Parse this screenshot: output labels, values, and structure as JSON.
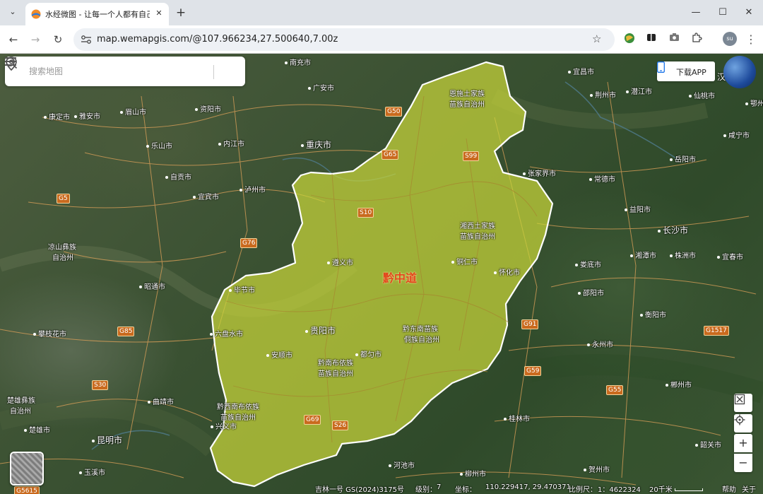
{
  "browser": {
    "tab_title": "水经微图 - 让每一个人都有自己",
    "url": "map.wemapgis.com/@107.966234,27.500640,7.00z",
    "profile_initials": "su"
  },
  "search": {
    "placeholder": "搜索地图"
  },
  "download_app_label": "下载APP",
  "region_label": "黔中道",
  "cities": [
    {
      "name": "南充市"
    },
    {
      "name": "广安市"
    },
    {
      "name": "宜昌市"
    },
    {
      "name": "荆州市"
    },
    {
      "name": "潜江市"
    },
    {
      "name": "武汉市"
    },
    {
      "name": "仙桃市"
    },
    {
      "name": "鄂州市"
    },
    {
      "name": "康定市"
    },
    {
      "name": "雅安市"
    },
    {
      "name": "眉山市"
    },
    {
      "name": "资阳市"
    },
    {
      "name": "恩施土家族"
    },
    {
      "name": "苗族自治州"
    },
    {
      "name": "乐山市"
    },
    {
      "name": "内江市"
    },
    {
      "name": "重庆市"
    },
    {
      "name": "咸宁市"
    },
    {
      "name": "岳阳市"
    },
    {
      "name": "张家界市"
    },
    {
      "name": "常德市"
    },
    {
      "name": "自贡市"
    },
    {
      "name": "宜宾市"
    },
    {
      "name": "泸州市"
    },
    {
      "name": "益阳市"
    },
    {
      "name": "湘西土家族"
    },
    {
      "name": "苗族自治州"
    },
    {
      "name": "长沙市"
    },
    {
      "name": "凉山彝族"
    },
    {
      "name": "自治州"
    },
    {
      "name": "湘潭市"
    },
    {
      "name": "株洲市"
    },
    {
      "name": "宜春市"
    },
    {
      "name": "遵义市"
    },
    {
      "name": "铜仁市"
    },
    {
      "name": "怀化市"
    },
    {
      "name": "娄底市"
    },
    {
      "name": "昭通市"
    },
    {
      "name": "毕节市"
    },
    {
      "name": "邵阳市"
    },
    {
      "name": "衡阳市"
    },
    {
      "name": "攀枝花市"
    },
    {
      "name": "六盘水市"
    },
    {
      "name": "贵阳市"
    },
    {
      "name": "黔东南苗族"
    },
    {
      "name": "侗族自治州"
    },
    {
      "name": "永州市"
    },
    {
      "name": "安顺市"
    },
    {
      "name": "都匀市"
    },
    {
      "name": "黔南布依族"
    },
    {
      "name": "苗族自治州"
    },
    {
      "name": "郴州市"
    },
    {
      "name": "楚雄彝族"
    },
    {
      "name": "自治州"
    },
    {
      "name": "曲靖市"
    },
    {
      "name": "黔西南布依族"
    },
    {
      "name": "苗族自治州"
    },
    {
      "name": "兴义市"
    },
    {
      "name": "楚雄市"
    },
    {
      "name": "昆明市"
    },
    {
      "name": "桂林市"
    },
    {
      "name": "韶关市"
    },
    {
      "name": "玉溪市"
    },
    {
      "name": "河池市"
    },
    {
      "name": "柳州市"
    },
    {
      "name": "贺州市"
    },
    {
      "name": "汉"
    }
  ],
  "highways": [
    "G50",
    "G65",
    "S99",
    "G5",
    "S10",
    "G76",
    "G85",
    "G91",
    "G1517",
    "G59",
    "S30",
    "G55",
    "G69",
    "S26",
    "G5615"
  ],
  "status": {
    "copyright": "吉林一号 GS(2024)3175号",
    "level_label": "级别：",
    "level_value": "7",
    "coord_label": "坐标：",
    "coord_value": "110.229417, 29.470371",
    "scale_label": "比例尺：",
    "scale_value": "1：4622324",
    "scale_bar_label": "20千米",
    "help": "帮助",
    "close": "关于"
  },
  "colors": {
    "region_fill": "#c8d63a",
    "region_stroke": "#ffffff",
    "road": "#e0a25a",
    "accent": "#1a73e8"
  },
  "icons": [
    "chevron-down-icon",
    "close-icon",
    "plus-icon",
    "minimize-icon",
    "maximize-icon",
    "back-icon",
    "forward-icon",
    "reload-icon",
    "site-info-icon",
    "star-icon",
    "menu-icon",
    "search-icon",
    "location-pin-icon",
    "phone-icon",
    "globe-icon",
    "fullscreen-icon",
    "locate-icon",
    "zoom-in-icon",
    "zoom-out-icon"
  ]
}
